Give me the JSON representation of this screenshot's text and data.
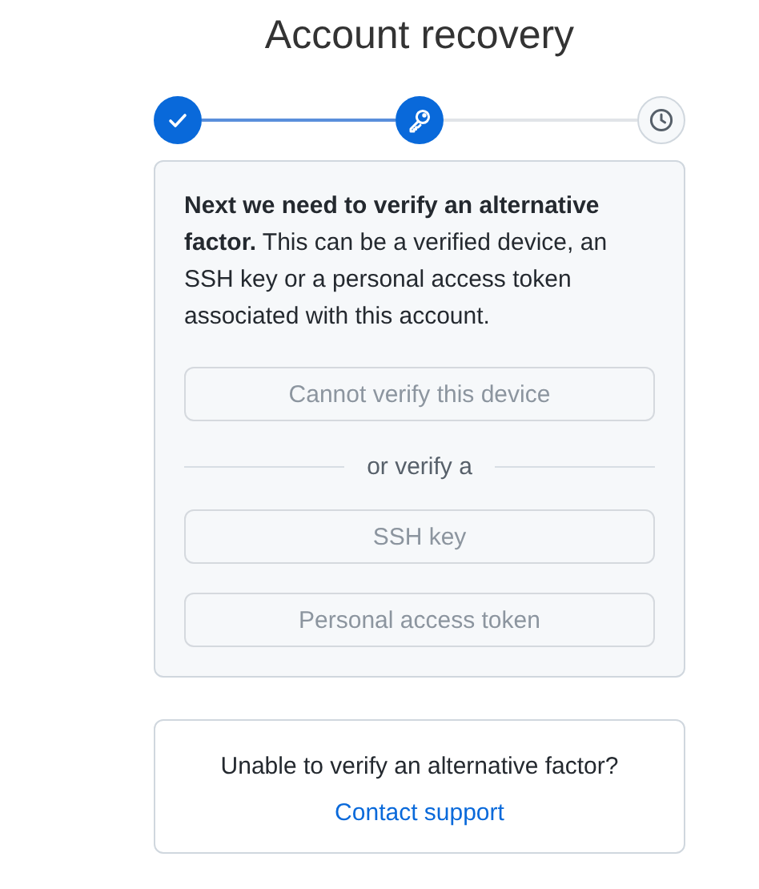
{
  "title": "Account recovery",
  "steps": [
    {
      "kind": "check",
      "reached": true
    },
    {
      "kind": "key",
      "reached": true
    },
    {
      "kind": "clock",
      "reached": false
    }
  ],
  "panel": {
    "description": "**Next we need to verify an alternative factor.** This can be a verified device, an SSH key or a personal access token associated with this account.",
    "primary_button": {
      "label": "Cannot verify this device",
      "disabled": true
    },
    "divider_text": "or verify a",
    "options": [
      {
        "label": "SSH key",
        "disabled": true
      },
      {
        "label": "Personal access token",
        "disabled": true
      }
    ]
  },
  "help": {
    "question": "Unable to verify an alternative factor?",
    "link": "Contact support"
  }
}
